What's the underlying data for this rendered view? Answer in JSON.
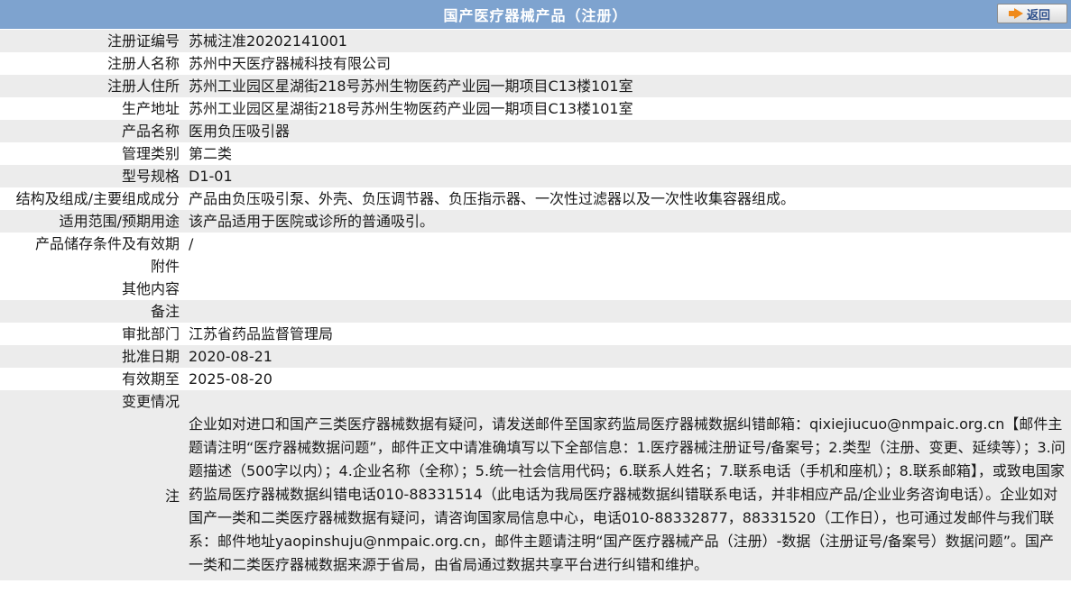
{
  "header": {
    "title": "国产医疗器械产品（注册）",
    "back_label": "返回"
  },
  "rows": [
    {
      "label": "注册证编号",
      "value": "苏械注准20202141001"
    },
    {
      "label": "注册人名称",
      "value": "苏州中天医疗器械科技有限公司"
    },
    {
      "label": "注册人住所",
      "value": "苏州工业园区星湖街218号苏州生物医药产业园一期项目C13楼101室"
    },
    {
      "label": "生产地址",
      "value": "苏州工业园区星湖街218号苏州生物医药产业园一期项目C13楼101室"
    },
    {
      "label": "产品名称",
      "value": "医用负压吸引器"
    },
    {
      "label": "管理类别",
      "value": "第二类"
    },
    {
      "label": "型号规格",
      "value": "D1-01"
    },
    {
      "label": "结构及组成/主要组成成分",
      "value": "产品由负压吸引泵、外壳、负压调节器、负压指示器、一次性过滤器以及一次性收集容器组成。"
    },
    {
      "label": "适用范围/预期用途",
      "value": "该产品适用于医院或诊所的普通吸引。"
    },
    {
      "label": "产品储存条件及有效期",
      "value": "/"
    },
    {
      "label": "附件",
      "value": ""
    },
    {
      "label": "其他内容",
      "value": ""
    },
    {
      "label": "备注",
      "value": ""
    },
    {
      "label": "审批部门",
      "value": "江苏省药品监督管理局"
    },
    {
      "label": "批准日期",
      "value": "2020-08-21"
    },
    {
      "label": "有效期至",
      "value": "2025-08-20"
    },
    {
      "label": "变更情况",
      "value": ""
    }
  ],
  "note": {
    "label": "注",
    "text": "企业如对进口和国产三类医疗器械数据有疑问，请发送邮件至国家药监局医疗器械数据纠错邮箱：qixiejiucuo@nmpaic.org.cn【邮件主题请注明“医疗器械数据问题”，邮件正文中请准确填写以下全部信息：1.医疗器械注册证号/备案号；2.类型（注册、变更、延续等）；3.问题描述（500字以内）；4.企业名称（全称）；5.统一社会信用代码；6.联系人姓名；7.联系电话（手机和座机）；8.联系邮箱】，或致电国家药监局医疗器械数据纠错电话010-88331514（此电话为我局医疗器械数据纠错联系电话，并非相应产品/企业业务咨询电话）。企业如对国产一类和二类医疗器械数据有疑问，请咨询国家局信息中心，电话010-88332877，88331520（工作日），也可通过发邮件与我们联系：邮件地址yaopinshuju@nmpaic.org.cn，邮件主题请注明“国产医疗器械产品（注册）-数据（注册证号/备案号）数据问题”。国产一类和二类医疗器械数据来源于省局，由省局通过数据共享平台进行纠错和维护。"
  },
  "colors": {
    "header_bg": "#7ea3cf",
    "alt_row_bg": "#ececec"
  }
}
